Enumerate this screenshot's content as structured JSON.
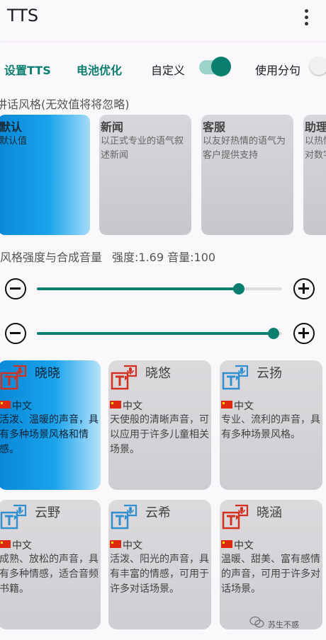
{
  "app": {
    "title": "TTS"
  },
  "toolbar": {
    "settings_tts": "设置TTS",
    "battery_opt": "电池优化",
    "custom_label": "自定义",
    "custom_on": true,
    "split_label": "使用分句",
    "split_on": false
  },
  "styles": {
    "section_label": "讲话风格(无效值将将忽略)",
    "items": [
      {
        "name": "默认",
        "desc": "默认值",
        "selected": true
      },
      {
        "name": "新闻",
        "desc": "以正式专业的语气叙述新闻",
        "selected": false
      },
      {
        "name": "客服",
        "desc": "以友好热情的语气为客户提供支持",
        "selected": false
      },
      {
        "name": "助理",
        "desc": "以热情而轻松的语气对数字助理讲话",
        "selected": false
      }
    ]
  },
  "sliders": {
    "label": "风格强度与合成音量",
    "strength_text": "强度:1.69 音量:100",
    "strength": 1.69,
    "volume": 100,
    "strength_fraction": 0.825,
    "volume_fraction": 0.965
  },
  "voices": {
    "items": [
      {
        "name": "晓晓",
        "lang": "中文",
        "desc": "活泼、温暖的声音，具有多种场景风格和情感。",
        "selected": true,
        "icon_color": "#d3301f"
      },
      {
        "name": "晓悠",
        "lang": "中文",
        "desc": "天使般的清晰声音，可以应用于许多儿童相关场景。",
        "selected": false,
        "icon_color": "#d3301f"
      },
      {
        "name": "云扬",
        "lang": "中文",
        "desc": "专业、流利的声音，具有多种场景风格。",
        "selected": false,
        "icon_color": "#2f8fd0"
      },
      {
        "name": "云野",
        "lang": "中文",
        "desc": "成熟、放松的声音，具有多种情感，适合音频书籍。",
        "selected": false,
        "icon_color": "#2f8fd0"
      },
      {
        "name": "云希",
        "lang": "中文",
        "desc": "活泼、阳光的声音，具有丰富的情感，可用于许多对话场景。",
        "selected": false,
        "icon_color": "#2f8fd0"
      },
      {
        "name": "晓涵",
        "lang": "中文",
        "desc": "温暖、甜美、富有感情的声音，可用于许多对话场景。",
        "selected": false,
        "icon_color": "#d3301f"
      }
    ]
  },
  "watermark": "苏生不惑",
  "colors": {
    "accent": "#0b7f6f",
    "selected_blue": "#1aa3ec"
  }
}
